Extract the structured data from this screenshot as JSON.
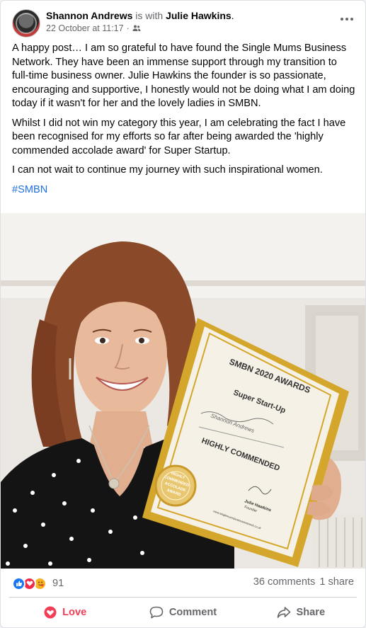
{
  "post": {
    "author": "Shannon Andrews",
    "with_text": "is with",
    "tagged": "Julie Hawkins",
    "tagged_suffix": ".",
    "date": "22 October at 11:17",
    "separator": "·",
    "audience_icon": "friends-icon",
    "paragraphs": [
      "A happy post… I am so grateful to have found the Single Mums Business Network. They have been an immense support through my transition to full-time business owner. Julie Hawkins the founder is so passionate, encouraging and supportive, I honestly would not be doing what I am doing today if it wasn't for her and the lovely ladies in SMBN.",
      "Whilst I did not win my category this year, I am celebrating the fact I have been recognised for my efforts so far after being awarded the 'highly commended accolade award' for Super Startup.",
      "I can not wait to continue my journey with such inspirational women."
    ],
    "hashtag": "#SMBN"
  },
  "certificate": {
    "title": "SMBN 2020 AWARDS",
    "category": "Super Start-Up",
    "recipient": "Shannon Andrews",
    "result": "HIGHLY COMMENDED",
    "seal_lines": [
      "HIGHLY",
      "COMMENDED",
      "ACCOLADE",
      "AWARD"
    ],
    "signatory": "Julie Hawkins",
    "signatory_role": "Founder",
    "website": "www.singlemumsbusinessnetwork.co.uk"
  },
  "reactions": {
    "types": [
      "like",
      "love",
      "care"
    ],
    "count": "91"
  },
  "engagement": {
    "comments": "36 comments",
    "shares": "1 share"
  },
  "actions": {
    "love": "Love",
    "comment": "Comment",
    "share": "Share"
  },
  "colors": {
    "accent": "#1877f2",
    "love": "#f33e58",
    "hashtag": "#216fdb",
    "muted": "#65676b",
    "gold": "#d4a72c"
  }
}
